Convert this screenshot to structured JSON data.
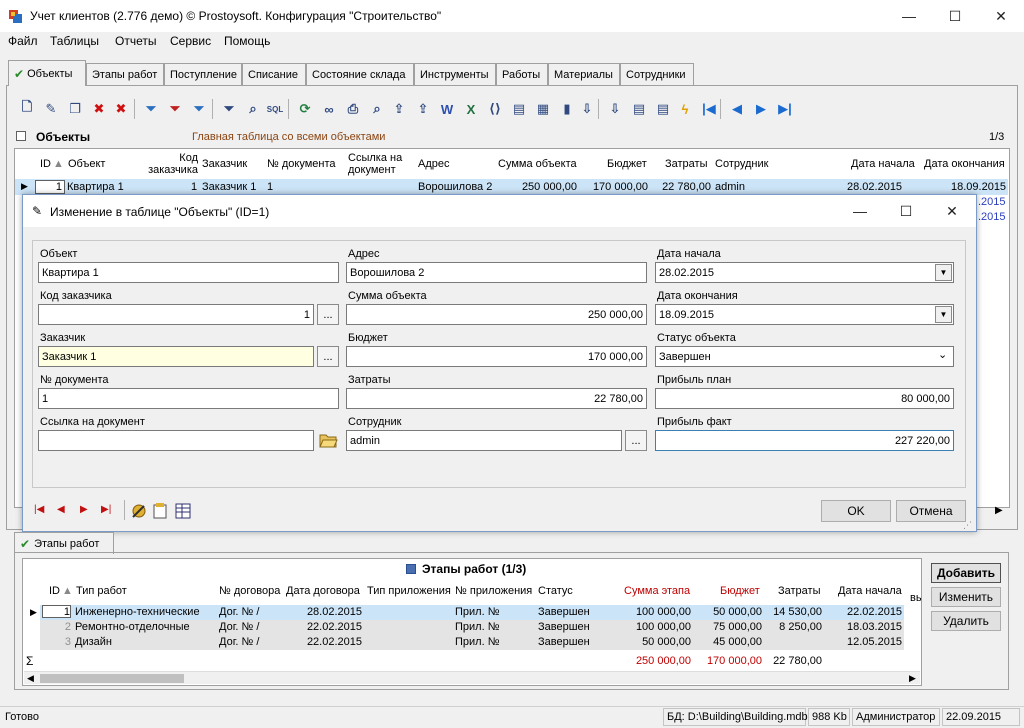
{
  "window": {
    "title": "Учет клиентов (2.776 демо) © Prostoysoft. Конфигурация \"Строительство\"",
    "minimize": "—",
    "maximize": "☐",
    "close": "✕"
  },
  "menu": [
    "Файл",
    "Таблицы",
    "Отчеты",
    "Сервис",
    "Помощь"
  ],
  "tabs": [
    "Объекты",
    "Этапы работ",
    "Поступление",
    "Списание",
    "Состояние склада",
    "Инструменты",
    "Работы",
    "Материалы",
    "Сотрудники"
  ],
  "toolbar_icons": [
    "new-record-icon",
    "edit-icon",
    "copy-icon",
    "delete-icon",
    "delete-all-icon",
    "filter-icon",
    "filter-clear-icon",
    "filter-remove-icon",
    "sort-icon",
    "search-icon",
    "sql-icon",
    "refresh-icon",
    "binoculars-icon",
    "print-icon",
    "preview-icon",
    "export-icon",
    "export2-icon",
    "word-icon",
    "excel-icon",
    "html-icon",
    "csv-icon",
    "xml-icon",
    "chart-icon",
    "import-icon",
    "import2-icon",
    "settings-icon",
    "report-icon",
    "lightning-icon",
    "first-icon",
    "prev-icon",
    "next-icon",
    "last-icon"
  ],
  "objects": {
    "section_title": "Объекты",
    "subtitle": "Главная таблица со всеми объектами",
    "pager": "1/3",
    "columns": [
      "ID",
      "Объект",
      "Код заказчика",
      "Заказчик",
      "№ документа",
      "Ссылка на документ",
      "Адрес",
      "Сумма объекта",
      "Бюджет",
      "Затраты",
      "Сотрудник",
      "Дата начала",
      "Дата окончания"
    ],
    "row": [
      "1",
      "Квартира 1",
      "1",
      "Заказчик 1",
      "1",
      "",
      "Ворошилова 2",
      "250 000,00",
      "170 000,00",
      "22 780,00",
      "admin",
      "28.02.2015",
      "18.09.2015"
    ],
    "hidden_rows_end_dates": [
      ".2015",
      ".2015"
    ]
  },
  "dialog": {
    "title": "Изменение в таблице \"Объекты\" (ID=1)",
    "minimize": "—",
    "maximize": "☐",
    "close": "✕",
    "fields": {
      "object_label": "Объект",
      "object_value": "Квартира 1",
      "client_code_label": "Код заказчика",
      "client_code_value": "1",
      "client_label": "Заказчик",
      "client_value": "Заказчик 1",
      "doc_no_label": "№ документа",
      "doc_no_value": "1",
      "doc_link_label": "Ссылка на документ",
      "doc_link_value": "",
      "address_label": "Адрес",
      "address_value": "Ворошилова 2",
      "sum_label": "Сумма объекта",
      "sum_value": "250 000,00",
      "budget_label": "Бюджет",
      "budget_value": "170 000,00",
      "costs_label": "Затраты",
      "costs_value": "22 780,00",
      "employee_label": "Сотрудник",
      "employee_value": "admin",
      "start_label": "Дата начала",
      "start_value": "28.02.2015",
      "end_label": "Дата окончания",
      "end_value": "18.09.2015",
      "status_label": "Статус объекта",
      "status_value": "Завершен",
      "profit_plan_label": "Прибыль план",
      "profit_plan_value": "80 000,00",
      "profit_fact_label": "Прибыль факт",
      "profit_fact_value": "227 220,00"
    },
    "ellipsis": "...",
    "ok": "OK",
    "cancel": "Отмена"
  },
  "stages": {
    "tab": "Этапы работ",
    "title": "Этапы работ (1/3)",
    "columns": [
      "ID",
      "Тип работ",
      "№ договора",
      "Дата договора",
      "Тип приложения",
      "№ приложения",
      "Статус",
      "Сумма этапа",
      "Бюджет",
      "Затраты",
      "Дата начала",
      "вь"
    ],
    "rows": [
      [
        "1",
        "Инженерно-технические",
        "Дог. № /",
        "28.02.2015",
        "",
        "Прил. №",
        "Завершен",
        "100 000,00",
        "50 000,00",
        "14 530,00",
        "22.02.2015"
      ],
      [
        "2",
        "Ремонтно-отделочные",
        "Дог. № /",
        "22.02.2015",
        "",
        "Прил. №",
        "Завершен",
        "100 000,00",
        "75 000,00",
        "8 250,00",
        "18.03.2015"
      ],
      [
        "3",
        "Дизайн",
        "Дог. № /",
        "22.02.2015",
        "",
        "Прил. №",
        "Завершен",
        "50 000,00",
        "45 000,00",
        "",
        "12.05.2015"
      ]
    ],
    "sigma": "Σ",
    "totals": [
      "250 000,00",
      "170 000,00",
      "22 780,00"
    ],
    "buttons": [
      "Добавить",
      "Изменить",
      "Удалить"
    ]
  },
  "statusbar": {
    "state": "Готово",
    "db_label": "БД:",
    "db_path": "D:\\Building\\Building.mdb",
    "size": "988 Kb",
    "user": "Администратор",
    "date": "22.09.2015"
  }
}
